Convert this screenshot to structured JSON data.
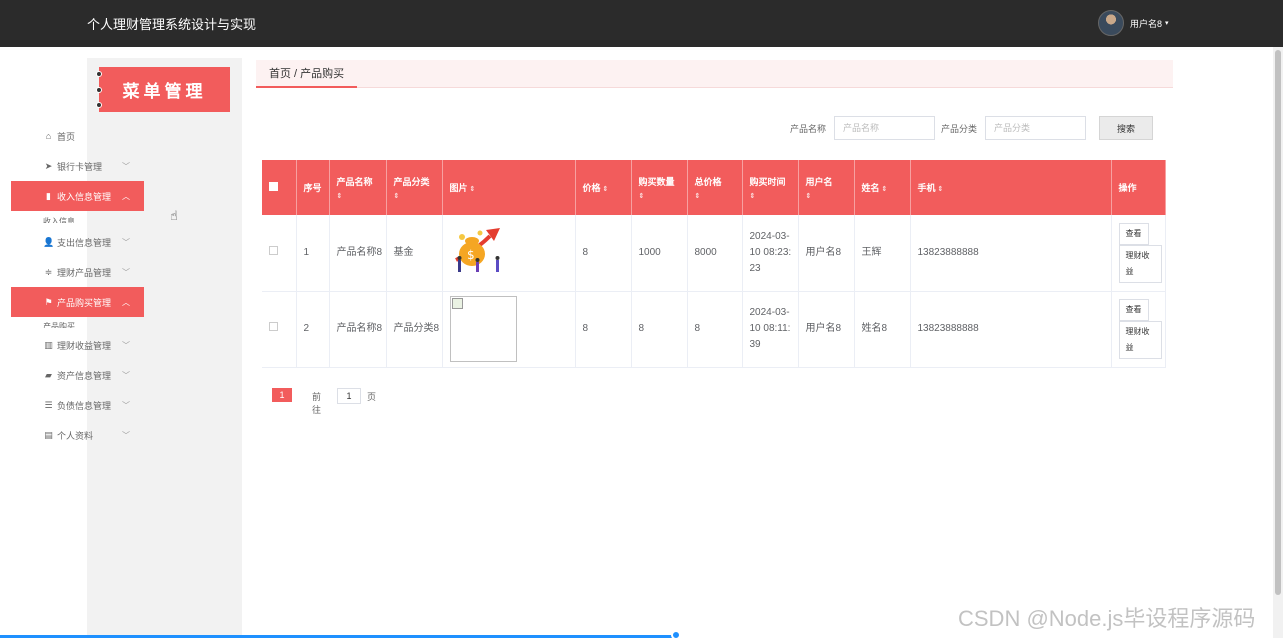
{
  "header": {
    "app_title": "个人理财管理系统设计与实现",
    "username": "用户名8",
    "caret": "▾"
  },
  "sidebar": {
    "banner": "菜单管理",
    "items": [
      {
        "label": "首页",
        "icon": "⌂",
        "chevron": ""
      },
      {
        "label": "银行卡管理",
        "icon": "➤",
        "chevron": "﹀"
      },
      {
        "label": "收入信息管理",
        "icon": "▮",
        "chevron": "︿"
      },
      {
        "label": "支出信息管理",
        "icon": "👤",
        "chevron": "﹀"
      },
      {
        "label": "理财产品管理",
        "icon": "≑",
        "chevron": "﹀"
      },
      {
        "label": "产品购买管理",
        "icon": "⚑",
        "chevron": "︿"
      },
      {
        "label": "理财收益管理",
        "icon": "▥",
        "chevron": "﹀"
      },
      {
        "label": "资产信息管理",
        "icon": "▰",
        "chevron": "﹀"
      },
      {
        "label": "负债信息管理",
        "icon": "☰",
        "chevron": "﹀"
      },
      {
        "label": "个人资料",
        "icon": "▤",
        "chevron": "﹀"
      }
    ],
    "sub_peek_1": "收入信息",
    "sub_peek_2": "产品购买"
  },
  "breadcrumb": "首页 / 产品购买",
  "search": {
    "name_label": "产品名称",
    "name_placeholder": "产品名称",
    "category_label": "产品分类",
    "category_placeholder": "产品分类",
    "button": "搜索"
  },
  "table": {
    "headers": {
      "index": "序号",
      "name": "产品名称",
      "category": "产品分类",
      "image": "图片",
      "price": "价格",
      "qty": "购买数量",
      "total": "总价格",
      "time": "购买时间",
      "username": "用户名",
      "realname": "姓名",
      "phone": "手机",
      "ops": "操作"
    },
    "sort_icon": "⇕",
    "rows": [
      {
        "index": "1",
        "name": "产品名称8",
        "category": "基金",
        "image": "money-growth-illustration",
        "price": "8",
        "qty": "1000",
        "total": "8000",
        "time": "2024-03-10 08:23:23",
        "username": "用户名8",
        "realname": "王辉",
        "phone": "13823888888",
        "view": "查看",
        "earnings": "理财收益"
      },
      {
        "index": "2",
        "name": "产品名称8",
        "category": "产品分类8",
        "image": "broken-image",
        "price": "8",
        "qty": "8",
        "total": "8",
        "time": "2024-03-10 08:11:39",
        "username": "用户名8",
        "realname": "姓名8",
        "phone": "13823888888",
        "view": "查看",
        "earnings": "理财收益"
      }
    ]
  },
  "pagination": {
    "current_page": "1",
    "goto_prefix": "前往",
    "goto_value": "1",
    "goto_suffix": "页"
  },
  "watermark": "CSDN @Node.js毕设程序源码",
  "colors": {
    "accent": "#f25c5c",
    "topbar": "#2b2b2b"
  }
}
